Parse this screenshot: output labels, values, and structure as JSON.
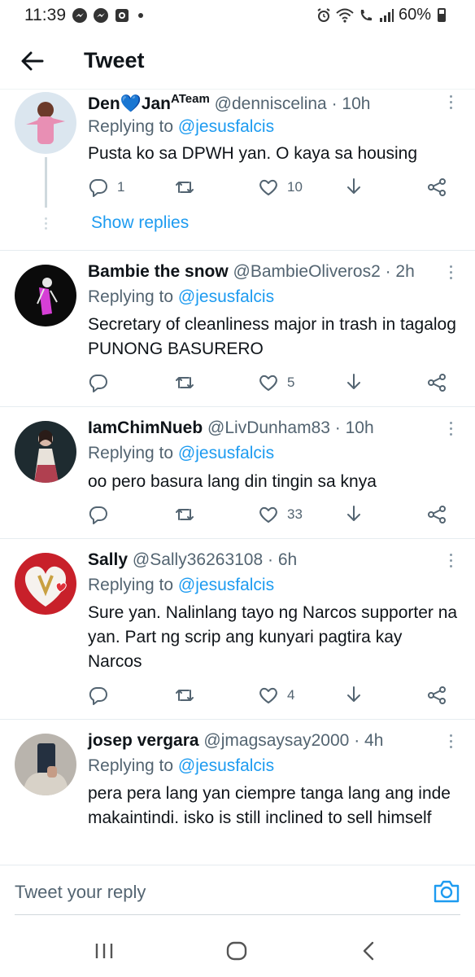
{
  "status_bar": {
    "time": "11:39",
    "battery": "60%",
    "left_icons": [
      "messenger-icon",
      "messenger-icon",
      "camera-app-icon",
      "dot-icon"
    ],
    "right_icons": [
      "alarm-icon",
      "wifi-icon",
      "wifi-call-icon",
      "signal-icon",
      "battery-icon"
    ]
  },
  "header": {
    "title": "Tweet"
  },
  "colors": {
    "accent": "#1d9bf0",
    "secondary_text": "#536471",
    "primary_text": "#0f1419"
  },
  "tweets": [
    {
      "name": "Den💙Jan",
      "name_sup": "ATeam",
      "handle": "@denniscelina",
      "time": "· 10h",
      "replying_label": "Replying to",
      "replying_to": "@jesusfalcis",
      "text": "Pusta ko sa DPWH yan. O kaya sa housing",
      "replies": "1",
      "retweets": "",
      "likes": "10",
      "show_replies": "Show replies"
    },
    {
      "name": "Bambie the snow",
      "handle": "@BambieOliveros2",
      "time": "· 2h",
      "replying_label": "Replying to",
      "replying_to": "@jesusfalcis",
      "text": "Secretary of cleanliness major in trash in tagalog PUNONG  BASURERO",
      "replies": "",
      "retweets": "",
      "likes": "5"
    },
    {
      "name": "IamChimNueb",
      "handle": "@LivDunham83",
      "time": "· 10h",
      "replying_label": "Replying to",
      "replying_to": "@jesusfalcis",
      "text": "oo pero basura lang din tingin sa knya",
      "replies": "",
      "retweets": "",
      "likes": "33"
    },
    {
      "name": "Sally",
      "handle": "@Sally36263108",
      "time": "· 6h",
      "replying_label": "Replying to",
      "replying_to": "@jesusfalcis",
      "text": "Sure yan. Nalinlang tayo ng Narcos supporter na yan. Part ng scrip ang kunyari pagtira kay Narcos",
      "replies": "",
      "retweets": "",
      "likes": "4"
    },
    {
      "name": "josep vergara",
      "handle": "@jmagsaysay2000",
      "time": "· 4h",
      "replying_label": "Replying to",
      "replying_to": "@jesusfalcis",
      "text": "pera pera lang yan ciempre tanga lang ang inde makaintindi.  isko is still inclined to sell himself"
    }
  ],
  "reply_bar": {
    "placeholder": "Tweet your reply"
  },
  "nav_bar": {
    "icons": [
      "recents-icon",
      "home-icon",
      "back-icon"
    ]
  }
}
